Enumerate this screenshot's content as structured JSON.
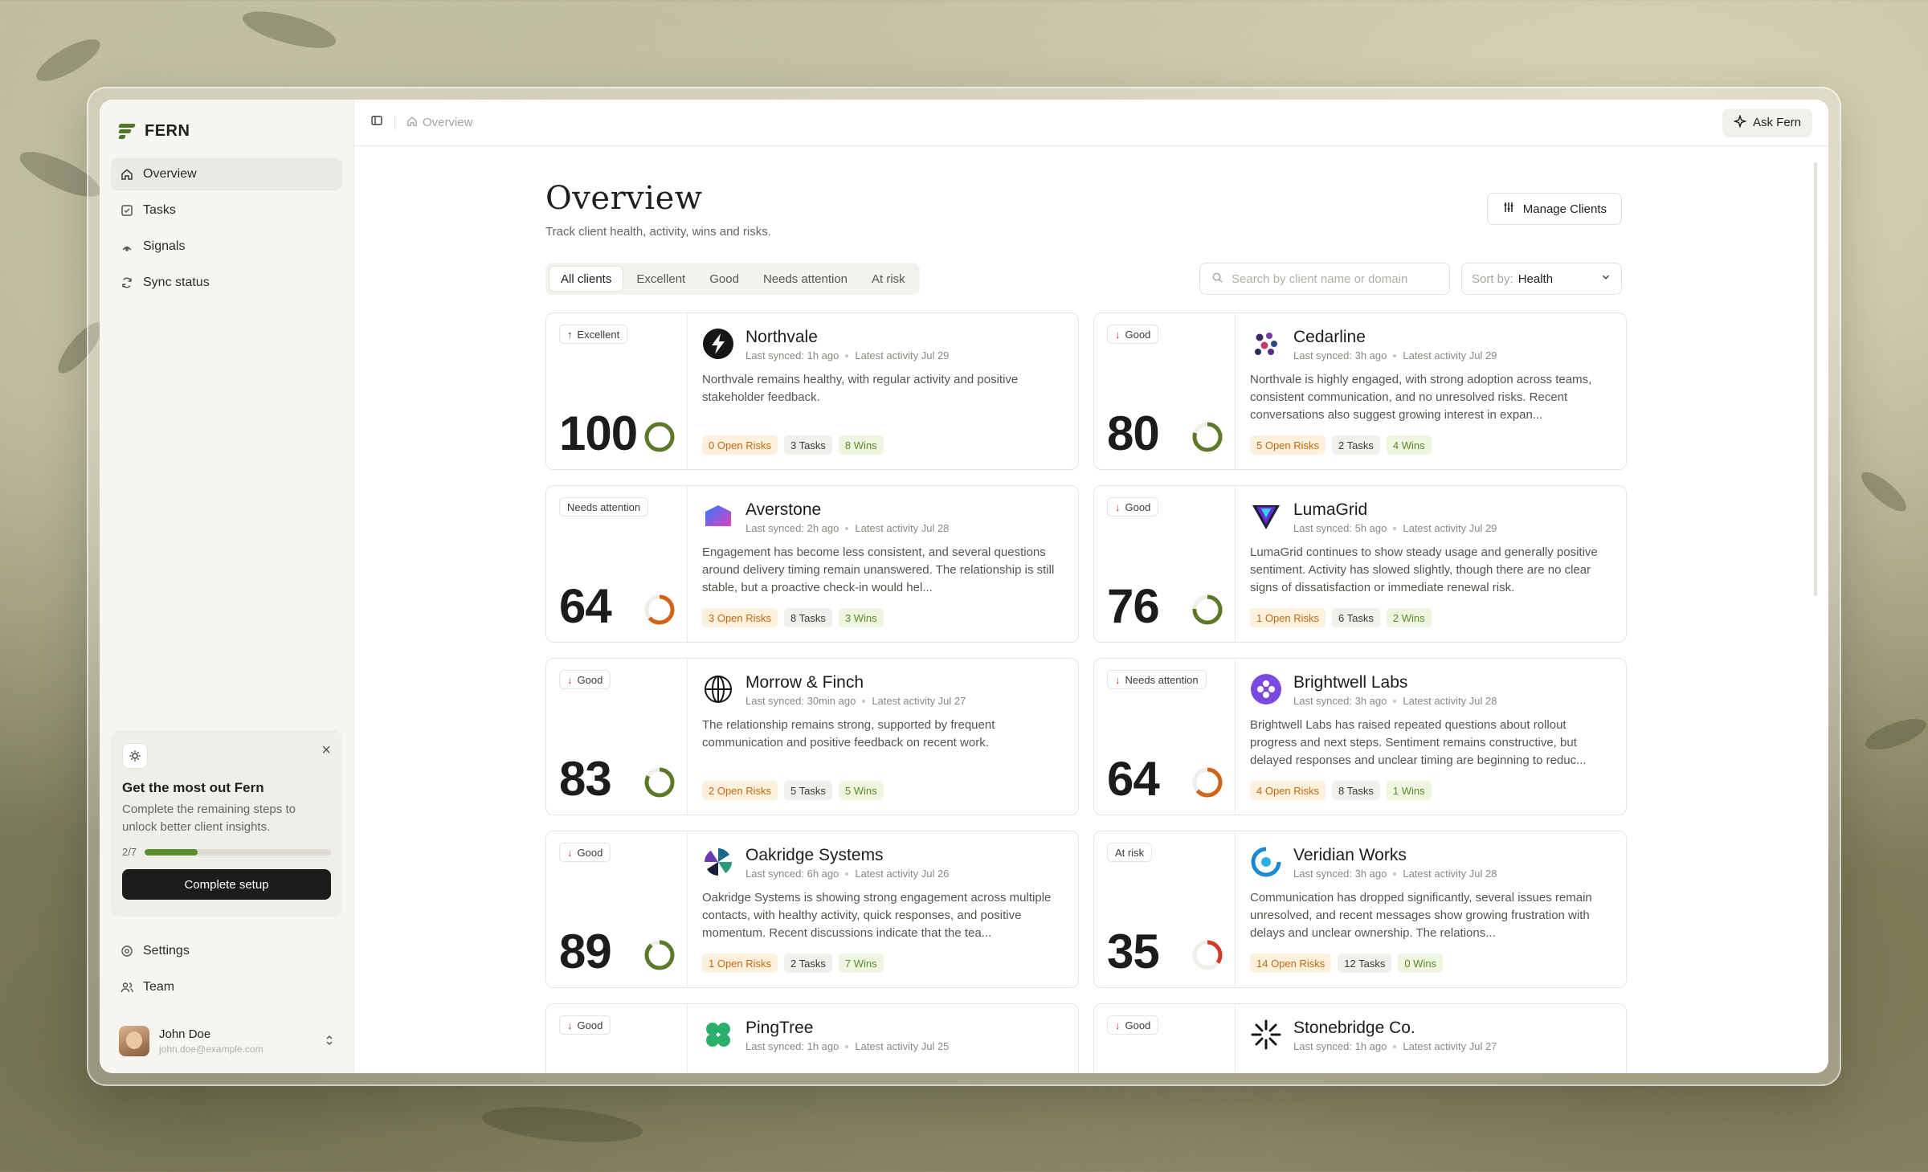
{
  "brand": {
    "name": "FERN"
  },
  "sidebar": {
    "items": [
      {
        "label": "Overview",
        "icon": "home-icon",
        "active": true
      },
      {
        "label": "Tasks",
        "icon": "checkbox-icon",
        "active": false
      },
      {
        "label": "Signals",
        "icon": "signal-icon",
        "active": false
      },
      {
        "label": "Sync status",
        "icon": "sync-icon",
        "active": false
      }
    ],
    "bottom_items": [
      {
        "label": "Settings",
        "icon": "gear-icon"
      },
      {
        "label": "Team",
        "icon": "users-icon"
      }
    ]
  },
  "promo": {
    "title": "Get the most out Fern",
    "text": "Complete the remaining steps to unlock better client insights.",
    "progress_label": "2/7",
    "progress_fraction": 0.2857,
    "button_label": "Complete setup"
  },
  "user": {
    "name": "John Doe",
    "email": "john.doe@example.com"
  },
  "topbar": {
    "breadcrumb": "Overview",
    "ask_label": "Ask Fern"
  },
  "page": {
    "title": "Overview",
    "subtitle": "Track client health, activity, wins and risks.",
    "manage_label": "Manage Clients"
  },
  "filters": {
    "tabs": [
      "All clients",
      "Excellent",
      "Good",
      "Needs attention",
      "At risk"
    ],
    "active_tab": 0,
    "search_placeholder": "Search by client name or domain",
    "sort_label": "Sort by:",
    "sort_value": "Health"
  },
  "colors": {
    "ring_green": "#5a7a2a",
    "ring_orange": "#d0651a",
    "ring_red": "#d23a2a",
    "accent": "#5c8c2e"
  },
  "clients": [
    {
      "name": "Northvale",
      "synced": "Last synced: 1h ago",
      "activity": "Latest activity Jul 29",
      "status": "Excellent",
      "trend": "up",
      "score": "100",
      "score_value": 100,
      "ring": "green",
      "summary": "Northvale remains healthy, with regular activity and positive stakeholder feedback.",
      "risks": "0 Open Risks",
      "tasks": "3 Tasks",
      "wins": "8 Wins",
      "logo": "bolt-logo-icon"
    },
    {
      "name": "Cedarline",
      "synced": "Last synced: 3h ago",
      "activity": "Latest activity Jul 29",
      "status": "Good",
      "trend": "down",
      "score": "80",
      "score_value": 80,
      "ring": "green",
      "summary": "Northvale is highly engaged, with strong adoption across teams, consistent communication, and no unresolved risks. Recent conversations also suggest growing interest in expan...",
      "risks": "5 Open Risks",
      "tasks": "2 Tasks",
      "wins": "4 Wins",
      "logo": "dots-logo-icon"
    },
    {
      "name": "Averstone",
      "synced": "Last synced: 2h ago",
      "activity": "Latest activity Jul 28",
      "status": "Needs attention",
      "trend": "none",
      "score": "64",
      "score_value": 64,
      "ring": "orange",
      "summary": "Engagement has become less consistent, and several questions around delivery timing remain unanswered. The relationship is still stable, but a proactive check-in would hel...",
      "risks": "3 Open Risks",
      "tasks": "8 Tasks",
      "wins": "3 Wins",
      "logo": "shape-logo-icon"
    },
    {
      "name": "LumaGrid",
      "synced": "Last synced: 5h ago",
      "activity": "Latest activity Jul 29",
      "status": "Good",
      "trend": "down",
      "score": "76",
      "score_value": 76,
      "ring": "green",
      "summary": "LumaGrid continues to show steady usage and generally positive sentiment. Activity has slowed slightly, though there are no clear signs of dissatisfaction or immediate renewal risk.",
      "risks": "1 Open Risks",
      "tasks": "6 Tasks",
      "wins": "2 Wins",
      "logo": "triangle-logo-icon"
    },
    {
      "name": "Morrow & Finch",
      "synced": "Last synced: 30min ago",
      "activity": "Latest activity Jul 27",
      "status": "Good",
      "trend": "down",
      "score": "83",
      "score_value": 83,
      "ring": "green",
      "summary": "The relationship remains strong, supported by frequent communication and positive feedback on recent work.",
      "risks": "2 Open Risks",
      "tasks": "5 Tasks",
      "wins": "5 Wins",
      "logo": "globe-logo-icon"
    },
    {
      "name": "Brightwell Labs",
      "synced": "Last synced: 3h ago",
      "activity": "Latest activity Jul 28",
      "status": "Needs attention",
      "trend": "down",
      "score": "64",
      "score_value": 64,
      "ring": "orange",
      "summary": "Brightwell Labs has raised repeated questions about rollout progress and next steps. Sentiment remains constructive, but delayed responses and unclear timing are beginning to reduc...",
      "risks": "4 Open Risks",
      "tasks": "8 Tasks",
      "wins": "1 Wins",
      "logo": "flower-logo-icon"
    },
    {
      "name": "Oakridge Systems",
      "synced": "Last synced: 6h ago",
      "activity": "Latest activity Jul 26",
      "status": "Good",
      "trend": "down",
      "score": "89",
      "score_value": 89,
      "ring": "green",
      "summary": "Oakridge Systems is showing strong engagement across multiple contacts, with healthy activity, quick responses, and positive momentum. Recent discussions indicate that the tea...",
      "risks": "1 Open Risks",
      "tasks": "2 Tasks",
      "wins": "7 Wins",
      "logo": "pinwheel-logo-icon"
    },
    {
      "name": "Veridian Works",
      "synced": "Last synced: 3h ago",
      "activity": "Latest activity Jul 28",
      "status": "At risk",
      "trend": "none",
      "score": "35",
      "score_value": 35,
      "ring": "red",
      "summary": "Communication has dropped significantly, several issues remain unresolved, and recent messages show growing frustration with delays and unclear ownership. The relations...",
      "risks": "14 Open Risks",
      "tasks": "12 Tasks",
      "wins": "0 Wins",
      "logo": "swirl-logo-icon"
    },
    {
      "name": "PingTree",
      "synced": "Last synced: 1h ago",
      "activity": "Latest activity Jul 25",
      "status": "Good",
      "trend": "down",
      "score": "",
      "score_value": 0,
      "ring": "green",
      "summary": "",
      "risks": "",
      "tasks": "",
      "wins": "",
      "logo": "clover-logo-icon"
    },
    {
      "name": "Stonebridge Co.",
      "synced": "Last synced: 1h ago",
      "activity": "Latest activity Jul 27",
      "status": "Good",
      "trend": "down",
      "score": "",
      "score_value": 0,
      "ring": "green",
      "summary": "",
      "risks": "",
      "tasks": "",
      "wins": "",
      "logo": "starburst-logo-icon"
    }
  ]
}
